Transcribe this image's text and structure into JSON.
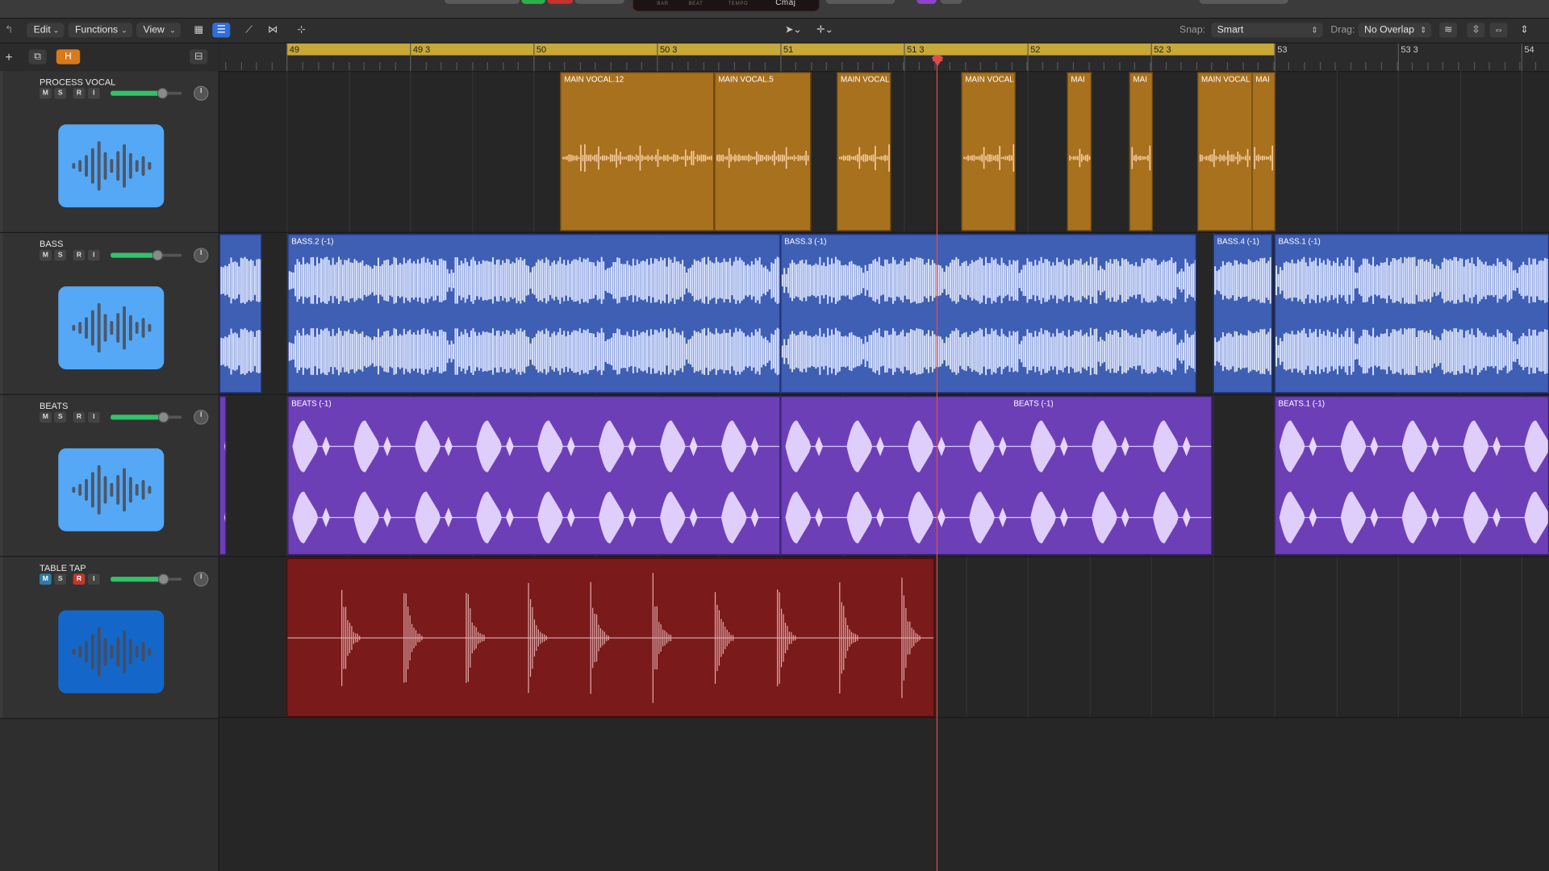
{
  "menus": {
    "edit": "Edit",
    "functions": "Functions",
    "view": "View"
  },
  "lcd": {
    "bar": "BAR",
    "beat": "BEAT",
    "tempo": "TEMPO",
    "key": "Cmaj"
  },
  "toolbar": {
    "snap_label": "Snap:",
    "snap_value": "Smart",
    "drag_label": "Drag:",
    "drag_value": "No Overlap",
    "track_header_h": "H"
  },
  "ruler": {
    "marks": [
      "49",
      "49 3",
      "50",
      "50 3",
      "51",
      "51 3",
      "52",
      "52 3",
      "53",
      "53 3",
      "54"
    ]
  },
  "tracks": [
    {
      "name": "PROCESS VOCAL",
      "mute": "M",
      "solo": "S",
      "record": "R",
      "input": "I",
      "volume": 0.72
    },
    {
      "name": "BASS",
      "mute": "M",
      "solo": "S",
      "record": "R",
      "input": "I",
      "volume": 0.65
    },
    {
      "name": "BEATS",
      "mute": "M",
      "solo": "S",
      "record": "R",
      "input": "I",
      "volume": 0.74
    },
    {
      "name": "TABLE TAP",
      "mute": "M",
      "solo": "S",
      "record": "R",
      "input": "I",
      "volume": 0.74
    }
  ],
  "regions": {
    "vocal": [
      "MAIN VOCAL.12",
      "MAIN VOCAL.5",
      "MAIN VOCAL",
      "MAIN VOCAL",
      "MAI",
      "MAI",
      "MAIN VOCAL",
      "MAI"
    ],
    "bass": [
      "BASS.2 (-1)",
      "BASS.3 (-1)",
      "BASS.4 (-1)",
      "BASS.1 (-1)"
    ],
    "beats": [
      "BEATS (-1)",
      "BEATS (-1)",
      "BEATS.1 (-1)"
    ],
    "tap": [
      ""
    ]
  },
  "colors": {
    "vocal": "#a8711e",
    "bass": "#3f5fb4",
    "beats": "#6c3fb7",
    "tap": "#7a1a1a",
    "cycle": "#c7a838",
    "playhead": "#e24b4b"
  }
}
